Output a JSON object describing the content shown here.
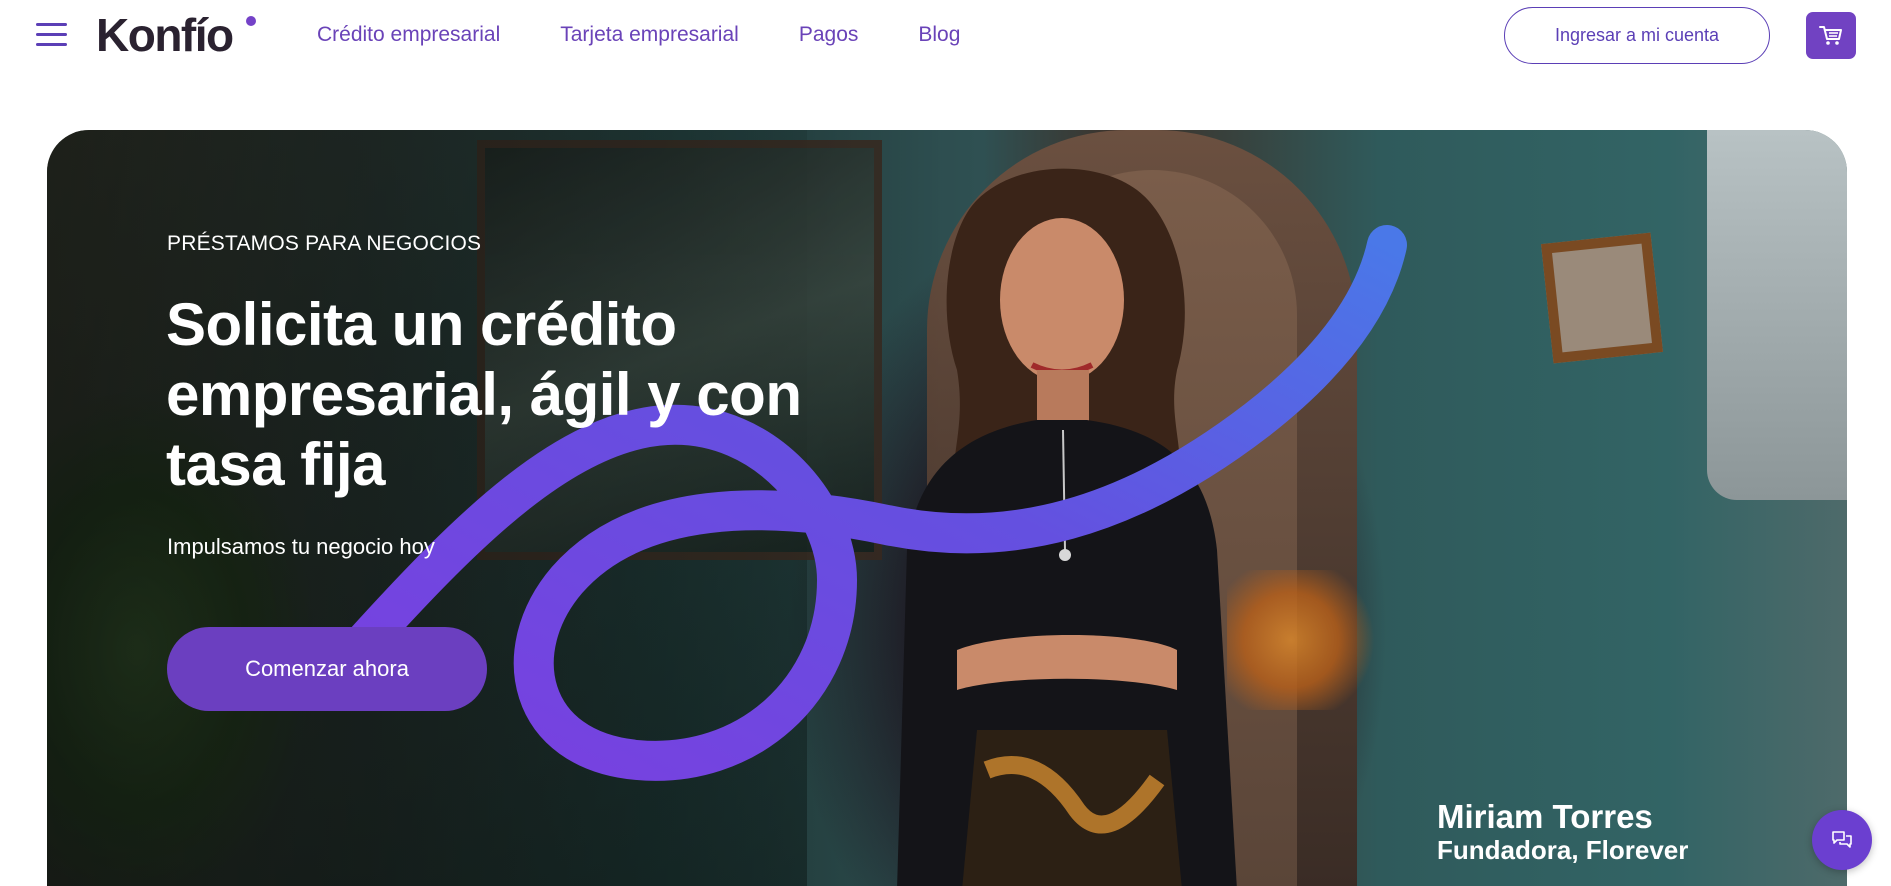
{
  "brand": {
    "logo_text": "Konfío",
    "accent": "#6b3fc0",
    "nav_text_color": "#6a43b8"
  },
  "nav": {
    "links": [
      {
        "label": "Crédito empresarial"
      },
      {
        "label": "Tarjeta empresarial"
      },
      {
        "label": "Pagos"
      },
      {
        "label": "Blog"
      }
    ],
    "login_label": "Ingresar a mi cuenta",
    "menu_icon": "hamburger-menu-icon",
    "cart_icon": "shopping-cart-icon"
  },
  "hero": {
    "eyebrow": "PRÉSTAMOS PARA NEGOCIOS",
    "headline": "Solicita un crédito empresarial, ágil y con tasa fija",
    "subline": "Impulsamos tu negocio hoy",
    "cta_label": "Comenzar ahora",
    "caption_name": "Miriam Torres",
    "caption_role": "Fundadora, Florever",
    "swirl_colors": [
      "#7a3fe0",
      "#4a78e8"
    ]
  },
  "chat": {
    "icon": "chat-bubbles-icon"
  }
}
